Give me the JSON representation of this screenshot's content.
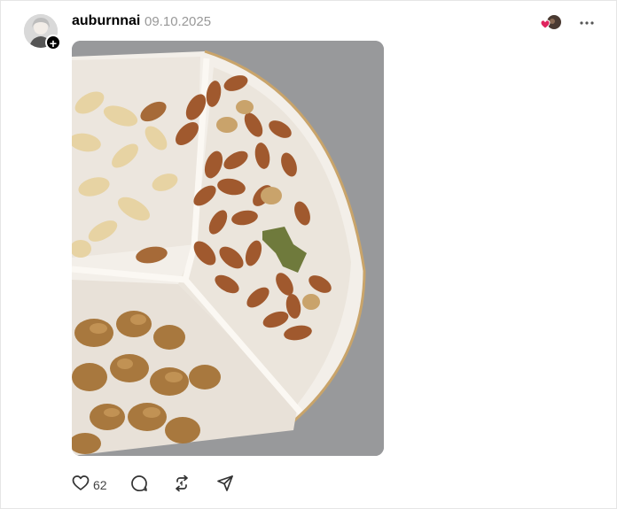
{
  "post": {
    "username": "auburnnai",
    "date": "09.10.2025",
    "follow_icon": "plus-icon",
    "image_alt_icon": "photo-of-nuts-in-divided-dish",
    "actions": {
      "like_icon": "heart-icon",
      "like_count": "62",
      "comment_icon": "comment-icon",
      "repost_icon": "repost-icon",
      "share_icon": "send-icon"
    },
    "menu_icon": "more-icon"
  },
  "colors": {
    "text_primary": "#000000",
    "text_secondary": "#999999",
    "heart_red": "#e0245e",
    "border": "#e5e5e5"
  }
}
